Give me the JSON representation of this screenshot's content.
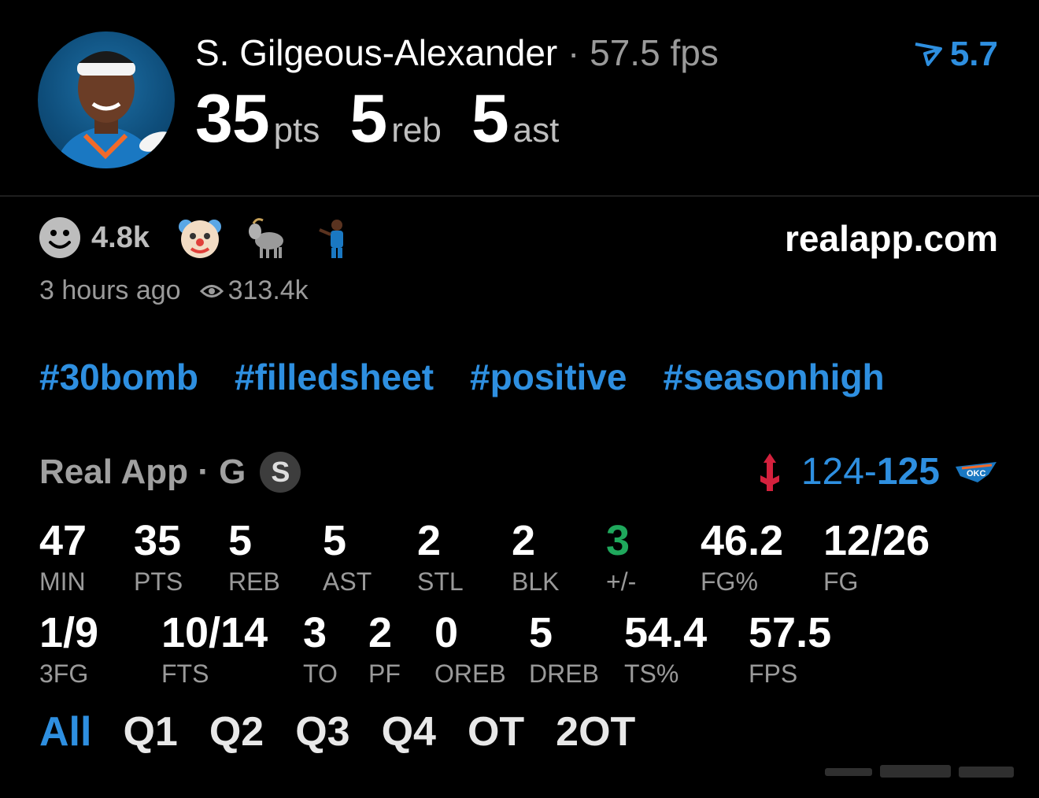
{
  "header": {
    "player_name": "S. Gilgeous-Alexander",
    "separator": "·",
    "fps_label": "57.5 fps",
    "trend_value": "5.7",
    "trend_icon": "trend-arrow-icon",
    "headline": [
      {
        "value": "35",
        "unit": "pts"
      },
      {
        "value": "5",
        "unit": "reb"
      },
      {
        "value": "5",
        "unit": "ast"
      }
    ]
  },
  "reactions": {
    "count": "4.8k",
    "icons": [
      "smiley-icon",
      "clown-emoji",
      "goat-emoji",
      "player-sticker"
    ]
  },
  "site": "realapp.com",
  "meta": {
    "time_ago": "3 hours ago",
    "views": "313.4k",
    "views_icon": "eye-icon"
  },
  "hashtags": [
    "#30bomb",
    "#filledsheet",
    "#positive",
    "#seasonhigh"
  ],
  "game": {
    "source": "Real App · G",
    "badge": "S",
    "score_home": "124",
    "score_dash": "-",
    "score_away": "125",
    "home_team_icon": "rockets-logo-icon",
    "away_team_icon": "thunder-logo-icon"
  },
  "stats_row1": [
    {
      "value": "47",
      "label": "MIN"
    },
    {
      "value": "35",
      "label": "PTS"
    },
    {
      "value": "5",
      "label": "REB"
    },
    {
      "value": "5",
      "label": "AST"
    },
    {
      "value": "2",
      "label": "STL"
    },
    {
      "value": "2",
      "label": "BLK"
    },
    {
      "value": "3",
      "label": "+/-"
    },
    {
      "value": "46.2",
      "label": "FG%"
    },
    {
      "value": "12/26",
      "label": "FG"
    }
  ],
  "stats_row2": [
    {
      "value": "1/9",
      "label": "3FG"
    },
    {
      "value": "10/14",
      "label": "FTS"
    },
    {
      "value": "3",
      "label": "TO"
    },
    {
      "value": "2",
      "label": "PF"
    },
    {
      "value": "0",
      "label": "OREB"
    },
    {
      "value": "5",
      "label": "DREB"
    },
    {
      "value": "54.4",
      "label": "TS%"
    },
    {
      "value": "57.5",
      "label": "FPS"
    }
  ],
  "periods": [
    "All",
    "Q1",
    "Q2",
    "Q3",
    "Q4",
    "OT",
    "2OT"
  ],
  "active_period": "All",
  "colors": {
    "accent": "#2e8fe0",
    "positive": "#1fa85c",
    "muted": "#9a9a9a",
    "background": "#000000"
  }
}
